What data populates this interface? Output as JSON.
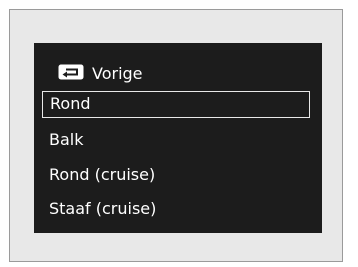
{
  "menu": {
    "back_label": "Vorige",
    "back_icon": "back-arrow-icon",
    "items": [
      {
        "label": "Rond",
        "selected": true
      },
      {
        "label": "Balk",
        "selected": false
      },
      {
        "label": "Rond (cruise)",
        "selected": false
      },
      {
        "label": "Staaf (cruise)",
        "selected": false
      }
    ]
  },
  "colors": {
    "screen_background": "#1c1c1c",
    "text": "#ffffff",
    "selection_border": "#e8e8e8",
    "panel_background": "#e8e8e8"
  }
}
